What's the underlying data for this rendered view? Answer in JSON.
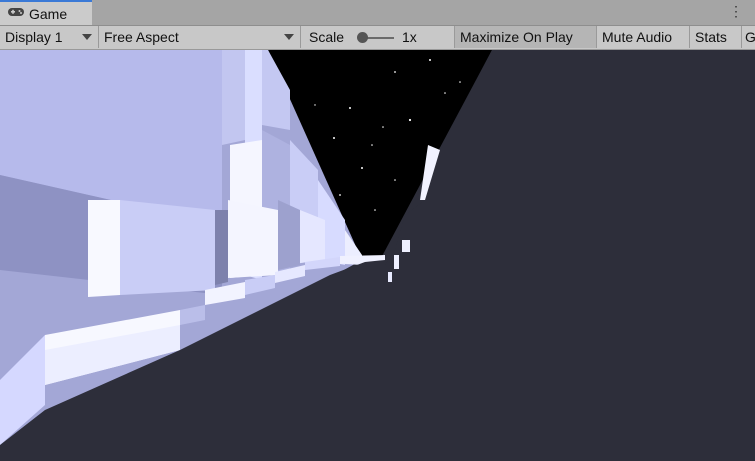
{
  "tab": {
    "label": "Game",
    "icon": "gamepad-icon"
  },
  "window": {
    "more_icon": "⋮"
  },
  "toolbar": {
    "display": "Display 1",
    "aspect": "Free Aspect",
    "scale_label": "Scale",
    "scale_value": "1x",
    "scale_fraction": 0.0,
    "maximize": "Maximize On Play",
    "mute": "Mute Audio",
    "stats": "Stats",
    "gizmos": "G"
  },
  "colors": {
    "sky": "#000000",
    "ground": "#2d2e3a",
    "building_light": "#c9cef5",
    "building_mid": "#a4a9d4",
    "building_shadow": "#8d91bd",
    "stars": "#ffffff"
  }
}
